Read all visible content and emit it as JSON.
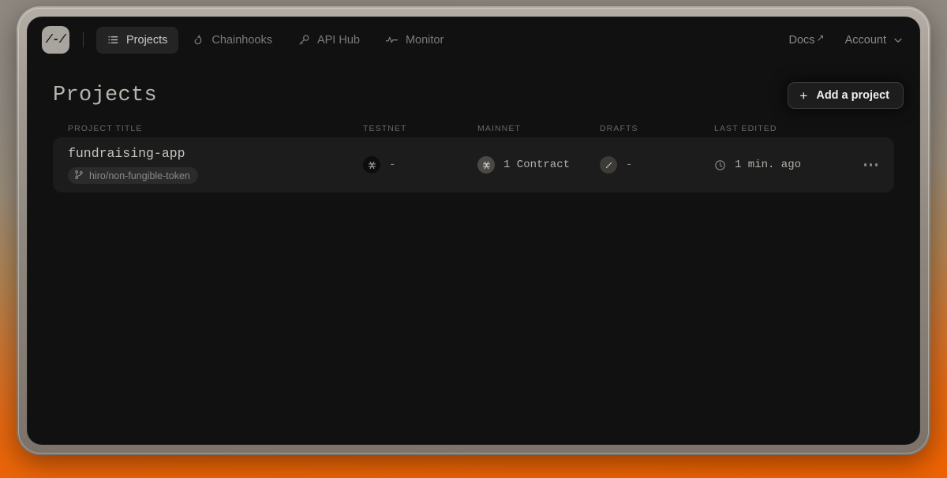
{
  "nav": {
    "logo_text": "/-/",
    "items": [
      {
        "label": "Projects",
        "icon": "list-icon",
        "active": true
      },
      {
        "label": "Chainhooks",
        "icon": "hook-icon",
        "active": false
      },
      {
        "label": "API Hub",
        "icon": "key-icon",
        "active": false
      },
      {
        "label": "Monitor",
        "icon": "pulse-icon",
        "active": false
      }
    ],
    "docs_label": "Docs",
    "docs_icon": "external-link-icon",
    "account_label": "Account",
    "account_icon": "chevron-down-icon"
  },
  "page": {
    "title": "Projects",
    "add_button_label": "Add a project",
    "add_button_icon": "plus-icon"
  },
  "table": {
    "columns": {
      "project_title": "PROJECT TITLE",
      "testnet": "TESTNET",
      "mainnet": "MAINNET",
      "drafts": "DRAFTS",
      "last_edited": "LAST EDITED"
    },
    "rows": [
      {
        "name": "fundraising-app",
        "repo_badge": "hiro/non-fungible-token",
        "repo_icon": "git-branch-icon",
        "testnet": {
          "icon": "stacks-icon",
          "value": "-"
        },
        "mainnet": {
          "icon": "stacks-icon",
          "value": "1 Contract"
        },
        "drafts": {
          "icon": "pencil-icon",
          "value": "-"
        },
        "last_edited": {
          "icon": "clock-icon",
          "value": "1 min. ago"
        },
        "menu_icon": "more-horizontal-icon"
      }
    ]
  },
  "colors": {
    "accent_orange": "#ef6200",
    "window_bg": "#111111",
    "row_bg": "#1c1c1c",
    "bezel": "#a39c93"
  }
}
